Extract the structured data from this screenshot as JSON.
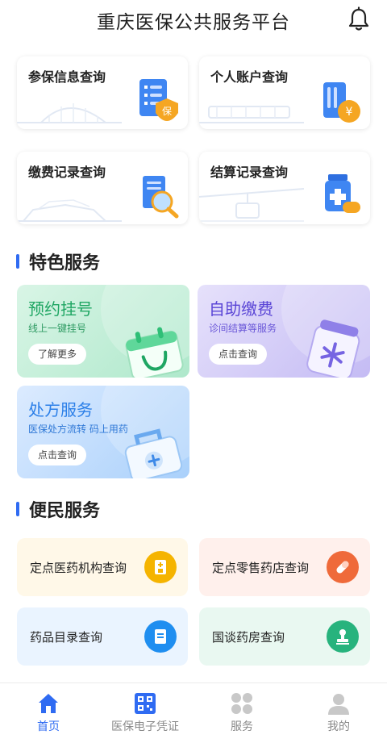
{
  "header": {
    "title": "重庆医保公共服务平台",
    "bell_icon": "bell-icon"
  },
  "query_cards": [
    {
      "label": "参保信息查询",
      "icon": "insured-info-icon"
    },
    {
      "label": "个人账户查询",
      "icon": "account-card-icon"
    },
    {
      "label": "缴费记录查询",
      "icon": "payment-record-search-icon"
    },
    {
      "label": "结算记录查询",
      "icon": "medicine-bottle-icon"
    }
  ],
  "featured": {
    "title": "特色服务",
    "cards": [
      {
        "title": "预约挂号",
        "subtitle": "线上一键挂号",
        "button": "了解更多",
        "color": "#20b06a"
      },
      {
        "title": "自助缴费",
        "subtitle": "诊间结算等服务",
        "button": "点击查询",
        "color": "#6a55e0"
      },
      {
        "title": "处方服务",
        "subtitle": "医保处方流转 码上用药",
        "button": "点击查询",
        "color": "#2b7fe8"
      }
    ]
  },
  "convenience": {
    "title": "便民服务",
    "cards": [
      {
        "label": "定点医药机构查询",
        "icon": "pharmacy-institution-icon",
        "color": "#f5b400"
      },
      {
        "label": "定点零售药店查询",
        "icon": "pill-icon",
        "color": "#ef6a3a"
      },
      {
        "label": "药品目录查询",
        "icon": "catalog-list-icon",
        "color": "#1f8ef0"
      },
      {
        "label": "国谈药房查询",
        "icon": "stamp-icon",
        "color": "#27b37d"
      }
    ]
  },
  "nav": {
    "items": [
      {
        "label": "首页",
        "icon": "home-icon",
        "active": true
      },
      {
        "label": "医保电子凭证",
        "icon": "qr-code-icon",
        "active": false
      },
      {
        "label": "服务",
        "icon": "services-grid-icon",
        "active": false
      },
      {
        "label": "我的",
        "icon": "profile-icon",
        "active": false
      }
    ],
    "active_color": "#2f6bf2"
  }
}
